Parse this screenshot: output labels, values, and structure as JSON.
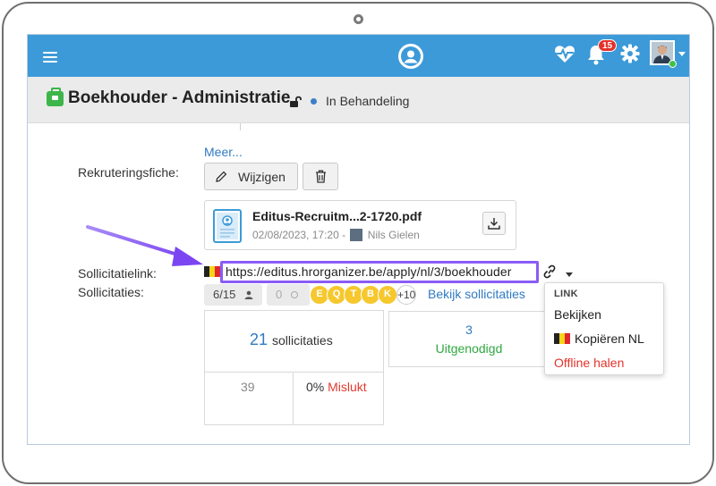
{
  "header": {
    "notifications_count": "15",
    "colors": {
      "topbar": "#3d9ad8",
      "badge": "#e4322b",
      "online": "#3fc24b"
    }
  },
  "title": {
    "text": "Boekhouder - Administratie",
    "status": "In Behandeling"
  },
  "recruitment": {
    "more_link": "Meer...",
    "label": "Rekruteringsfiche:",
    "edit_label": "Wijzigen",
    "file": {
      "name": "Editus-Recruitm...2-1720.pdf",
      "date": "02/08/2023, 17:20 -",
      "author": "Nils Gielen"
    }
  },
  "application_link": {
    "label": "Sollicitatielink:",
    "url": "https://editus.hrorganizer.be/apply/nl/3/boekhouder"
  },
  "applications": {
    "label": "Sollicitaties:",
    "count_pill": "6/15",
    "zero_pill": "0",
    "initials": [
      "E",
      "Q",
      "T",
      "B",
      "K"
    ],
    "more": "+10",
    "view_link": "Bekijk sollicitaties"
  },
  "stats": {
    "total_num": "21",
    "total_label": "sollicitaties",
    "small_num": "39",
    "failed_pct": "0%",
    "failed_label": "Mislukt",
    "invited_num": "3",
    "invited_label": "Uitgenodigd"
  },
  "link_menu": {
    "heading": "LINK",
    "items": [
      "Bekijken",
      "Kopiëren NL",
      "Offline halen"
    ]
  }
}
